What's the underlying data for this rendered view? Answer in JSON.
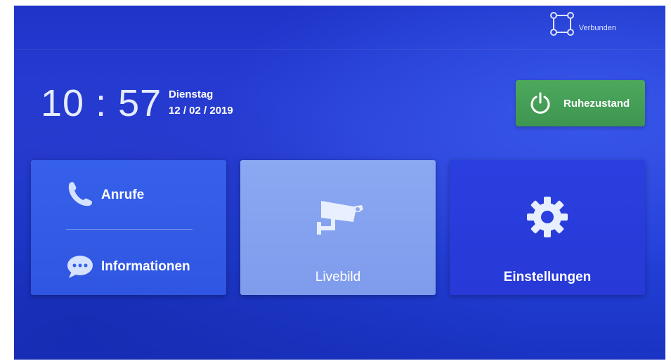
{
  "status": {
    "connection_label": "Verbunden"
  },
  "clock": {
    "time": "10 : 57",
    "day": "Dienstag",
    "date": "12 / 02 / 2019"
  },
  "standby": {
    "label": "Ruhezustand"
  },
  "tiles": {
    "calls_label": "Anrufe",
    "info_label": "Informationen",
    "live_label": "Livebild",
    "settings_label": "Einstellungen"
  },
  "colors": {
    "background": "#2a3fd6",
    "standby_green": "#4da85c",
    "tile_left": "#3660ea",
    "tile_mid": "#8ba8f2",
    "tile_right": "#2b3fe0",
    "icon_light_blue": "#d4e2ff"
  },
  "icons": {
    "status": "network-connected-icon",
    "standby": "power-icon",
    "calls": "phone-icon",
    "info": "chat-bubble-icon",
    "live": "security-camera-icon",
    "settings": "gear-icon"
  }
}
